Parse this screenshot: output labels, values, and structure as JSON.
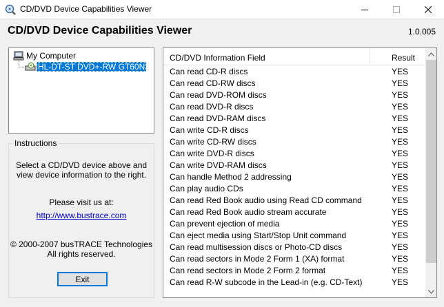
{
  "window": {
    "title": "CD/DVD Device Capabilities Viewer"
  },
  "header": {
    "title": "CD/DVD Device Capabilities Viewer",
    "version": "1.0.005"
  },
  "tree": {
    "root": "My Computer",
    "device": "HL-DT-ST DVD+-RW GT60N"
  },
  "instructions": {
    "legend": "Instructions",
    "line1": "Select a CD/DVD device above and",
    "line2": "view device information to the right.",
    "visit": "Please visit us at:",
    "link": "http://www.bustrace.com",
    "copyright1": "© 2000-2007 busTRACE Technologies",
    "copyright2": "All rights reserved.",
    "exit_label": "Exit"
  },
  "list": {
    "columns": {
      "field": "CD/DVD Information Field",
      "result": "Result"
    },
    "rows": [
      {
        "field": "Can read CD-R discs",
        "result": "YES"
      },
      {
        "field": "Can read CD-RW discs",
        "result": "YES"
      },
      {
        "field": "Can read DVD-ROM discs",
        "result": "YES"
      },
      {
        "field": "Can read DVD-R discs",
        "result": "YES"
      },
      {
        "field": "Can read DVD-RAM discs",
        "result": "YES"
      },
      {
        "field": "Can write CD-R discs",
        "result": "YES"
      },
      {
        "field": "Can write CD-RW discs",
        "result": "YES"
      },
      {
        "field": "Can write DVD-R discs",
        "result": "YES"
      },
      {
        "field": "Can write DVD-RAM discs",
        "result": "YES"
      },
      {
        "field": "Can handle Method 2 addressing",
        "result": "YES"
      },
      {
        "field": "Can play audio CDs",
        "result": "YES"
      },
      {
        "field": "Can read Red Book audio using Read CD command",
        "result": "YES"
      },
      {
        "field": "Can read Red Book audio stream accurate",
        "result": "YES"
      },
      {
        "field": "Can prevent ejection of media",
        "result": "YES"
      },
      {
        "field": "Can eject media using Start/Stop Unit command",
        "result": "YES"
      },
      {
        "field": "Can read multisession discs or Photo-CD discs",
        "result": "YES"
      },
      {
        "field": "Can read sectors in Mode 2 Form 1 (XA) format",
        "result": "YES"
      },
      {
        "field": "Can read sectors in Mode 2 Form 2 format",
        "result": "YES"
      },
      {
        "field": "Can read R-W subcode in the Lead-in (e.g. CD-Text)",
        "result": "YES"
      }
    ]
  }
}
